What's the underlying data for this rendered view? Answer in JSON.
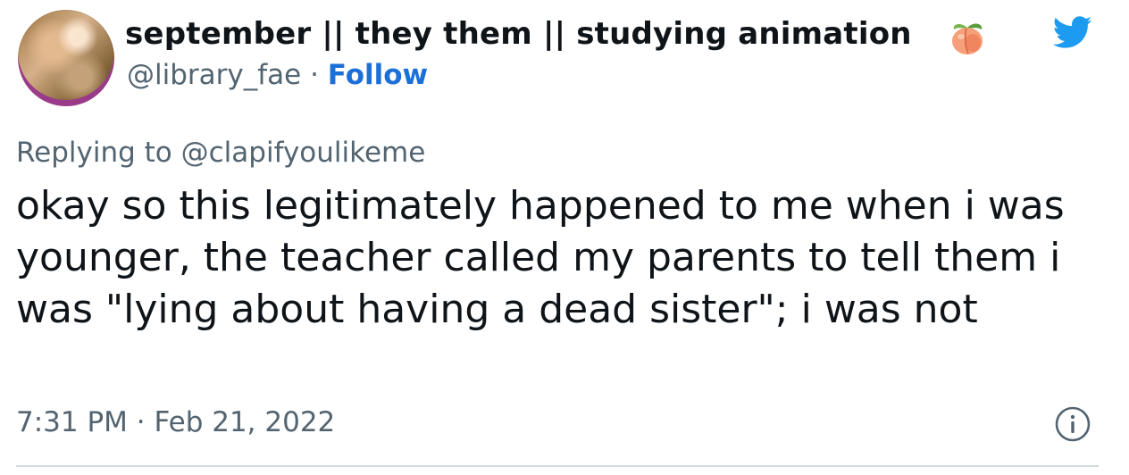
{
  "user": {
    "display_name": "september || they them || studying animation",
    "name_emoji": "peach-icon",
    "handle": "@library_fae",
    "separator": " · ",
    "follow_label": "Follow"
  },
  "reply": {
    "prefix": "Replying to ",
    "target": "@clapifyoulikeme"
  },
  "tweet": {
    "text": "okay so this legitimately happened to me when i was younger, the teacher called my parents to tell them i was \"lying about having a dead sister\"; i was not",
    "time": "7:31 PM",
    "date_separator": " · ",
    "date": "Feb 21, 2022"
  },
  "icons": {
    "brand": "twitter-bird-icon",
    "info": "info-icon"
  },
  "colors": {
    "link_blue": "#1d6fd8",
    "twitter_blue": "#1d9bf0",
    "secondary_text": "#536471",
    "primary_text": "#0f1419",
    "divider": "#cfd9de"
  }
}
